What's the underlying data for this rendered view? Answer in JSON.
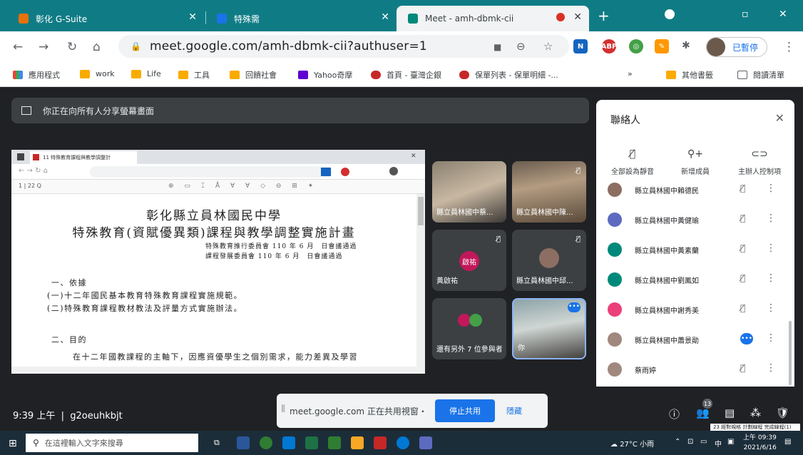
{
  "tabs": [
    {
      "label": "彰化 G-Suite",
      "color": "#e8710a"
    },
    {
      "label": "特殊需",
      "color": "#1a73e8"
    },
    {
      "label": "Meet - amh-dbmk-cii",
      "color": "#00897b"
    }
  ],
  "address": {
    "url": "meet.google.com/amh-dbmk-cii?authuser=1"
  },
  "profile": {
    "label": "已暫停"
  },
  "bookmarks": [
    "應用程式",
    "work",
    "Life",
    "工具",
    "回饋社會",
    "Yahoo奇摩",
    "首頁 - 臺灣企銀",
    "保單列表 - 保單明細 -...",
    "其他書籤",
    "閱讀清單"
  ],
  "meet": {
    "banner": "你正在向所有人分享螢幕畫面",
    "time": "9:39 上午",
    "code": "g2oeuhkbjt",
    "participant_count": "13",
    "tooltip": "23 經對規格 計劃線程 完成線程(1)",
    "share_popup": {
      "message": "meet.google.com 正在共用視窗・",
      "stop": "停止共用",
      "hide": "隱藏"
    }
  },
  "doc": {
    "title1": "彰化縣立員林國民中學",
    "title2": "特殊教育(資賦優異類)課程與教學調整實施計畫",
    "sub1": "特殊教育推行委員會 110 年 6 月　日會議通過",
    "sub2": "課程發展委員會 110 年 6 月　日會議通過",
    "h1": "一、依據",
    "p1": "(一)十二年國民基本教育特殊教育課程實施規範。",
    "p2": "(二)特殊教育課程教材教法及評量方式實施辦法。",
    "h2": "二、目的",
    "p3": "在十二年國教課程的主軸下，因應資優學生之個別需求，能力差異及學習",
    "tab_label": "11 特殊教育課程與教學調整計"
  },
  "tiles": [
    {
      "name": "縣立員林國中蔡...",
      "color": "#6a6055"
    },
    {
      "name": "縣立員林國中陳...",
      "color": "#7a6a58"
    },
    {
      "name": "黃啟祐",
      "initials": "啟祐",
      "color": "#c2185b"
    },
    {
      "name": "縣立員林國中邱...",
      "color": "#8d6e63"
    },
    {
      "name": "還有另外 7 位參與者",
      "color": "#43a047"
    },
    {
      "name": "你",
      "color": "#5a6068"
    }
  ],
  "people": {
    "title": "聯絡人",
    "actions": [
      "全部設為靜音",
      "新增成員",
      "主辦人控制項"
    ],
    "rows": [
      {
        "name": "縣立員林國中賴德民",
        "color": "#8d6e63"
      },
      {
        "name": "縣立員林國中黃健瑜",
        "color": "#5c6bc0"
      },
      {
        "name": "縣立員林國中黃素蘭",
        "color": "#00897b"
      },
      {
        "name": "縣立員林國中劉鳳如",
        "color": "#00897b"
      },
      {
        "name": "縣立員林國中謝秀美",
        "color": "#ec407a"
      },
      {
        "name": "縣立員林國中蕭景勛",
        "color": "#a1887f"
      },
      {
        "name": "蔡雨婷",
        "color": "#a1887f"
      }
    ]
  },
  "taskbar": {
    "search": "在這裡輸入文字來搜尋",
    "weather": "27°C 小雨",
    "ime": "中",
    "time": "上午 09:39",
    "date": "2021/6/16"
  }
}
